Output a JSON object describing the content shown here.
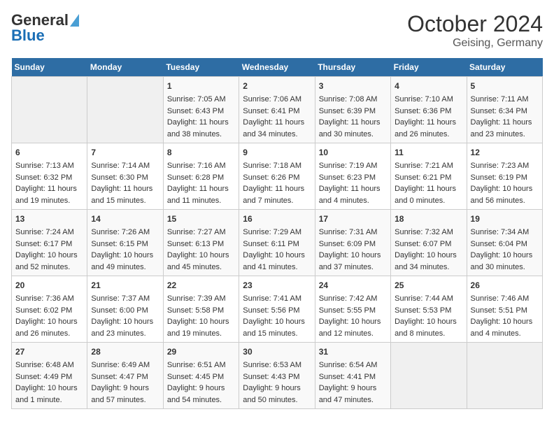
{
  "logo": {
    "part1": "General",
    "part2": "Blue"
  },
  "title": "October 2024",
  "subtitle": "Geising, Germany",
  "headers": [
    "Sunday",
    "Monday",
    "Tuesday",
    "Wednesday",
    "Thursday",
    "Friday",
    "Saturday"
  ],
  "weeks": [
    [
      {
        "day": "",
        "empty": true
      },
      {
        "day": "",
        "empty": true
      },
      {
        "day": "1",
        "sunrise": "Sunrise: 7:05 AM",
        "sunset": "Sunset: 6:43 PM",
        "daylight": "Daylight: 11 hours and 38 minutes."
      },
      {
        "day": "2",
        "sunrise": "Sunrise: 7:06 AM",
        "sunset": "Sunset: 6:41 PM",
        "daylight": "Daylight: 11 hours and 34 minutes."
      },
      {
        "day": "3",
        "sunrise": "Sunrise: 7:08 AM",
        "sunset": "Sunset: 6:39 PM",
        "daylight": "Daylight: 11 hours and 30 minutes."
      },
      {
        "day": "4",
        "sunrise": "Sunrise: 7:10 AM",
        "sunset": "Sunset: 6:36 PM",
        "daylight": "Daylight: 11 hours and 26 minutes."
      },
      {
        "day": "5",
        "sunrise": "Sunrise: 7:11 AM",
        "sunset": "Sunset: 6:34 PM",
        "daylight": "Daylight: 11 hours and 23 minutes."
      }
    ],
    [
      {
        "day": "6",
        "sunrise": "Sunrise: 7:13 AM",
        "sunset": "Sunset: 6:32 PM",
        "daylight": "Daylight: 11 hours and 19 minutes."
      },
      {
        "day": "7",
        "sunrise": "Sunrise: 7:14 AM",
        "sunset": "Sunset: 6:30 PM",
        "daylight": "Daylight: 11 hours and 15 minutes."
      },
      {
        "day": "8",
        "sunrise": "Sunrise: 7:16 AM",
        "sunset": "Sunset: 6:28 PM",
        "daylight": "Daylight: 11 hours and 11 minutes."
      },
      {
        "day": "9",
        "sunrise": "Sunrise: 7:18 AM",
        "sunset": "Sunset: 6:26 PM",
        "daylight": "Daylight: 11 hours and 7 minutes."
      },
      {
        "day": "10",
        "sunrise": "Sunrise: 7:19 AM",
        "sunset": "Sunset: 6:23 PM",
        "daylight": "Daylight: 11 hours and 4 minutes."
      },
      {
        "day": "11",
        "sunrise": "Sunrise: 7:21 AM",
        "sunset": "Sunset: 6:21 PM",
        "daylight": "Daylight: 11 hours and 0 minutes."
      },
      {
        "day": "12",
        "sunrise": "Sunrise: 7:23 AM",
        "sunset": "Sunset: 6:19 PM",
        "daylight": "Daylight: 10 hours and 56 minutes."
      }
    ],
    [
      {
        "day": "13",
        "sunrise": "Sunrise: 7:24 AM",
        "sunset": "Sunset: 6:17 PM",
        "daylight": "Daylight: 10 hours and 52 minutes."
      },
      {
        "day": "14",
        "sunrise": "Sunrise: 7:26 AM",
        "sunset": "Sunset: 6:15 PM",
        "daylight": "Daylight: 10 hours and 49 minutes."
      },
      {
        "day": "15",
        "sunrise": "Sunrise: 7:27 AM",
        "sunset": "Sunset: 6:13 PM",
        "daylight": "Daylight: 10 hours and 45 minutes."
      },
      {
        "day": "16",
        "sunrise": "Sunrise: 7:29 AM",
        "sunset": "Sunset: 6:11 PM",
        "daylight": "Daylight: 10 hours and 41 minutes."
      },
      {
        "day": "17",
        "sunrise": "Sunrise: 7:31 AM",
        "sunset": "Sunset: 6:09 PM",
        "daylight": "Daylight: 10 hours and 37 minutes."
      },
      {
        "day": "18",
        "sunrise": "Sunrise: 7:32 AM",
        "sunset": "Sunset: 6:07 PM",
        "daylight": "Daylight: 10 hours and 34 minutes."
      },
      {
        "day": "19",
        "sunrise": "Sunrise: 7:34 AM",
        "sunset": "Sunset: 6:04 PM",
        "daylight": "Daylight: 10 hours and 30 minutes."
      }
    ],
    [
      {
        "day": "20",
        "sunrise": "Sunrise: 7:36 AM",
        "sunset": "Sunset: 6:02 PM",
        "daylight": "Daylight: 10 hours and 26 minutes."
      },
      {
        "day": "21",
        "sunrise": "Sunrise: 7:37 AM",
        "sunset": "Sunset: 6:00 PM",
        "daylight": "Daylight: 10 hours and 23 minutes."
      },
      {
        "day": "22",
        "sunrise": "Sunrise: 7:39 AM",
        "sunset": "Sunset: 5:58 PM",
        "daylight": "Daylight: 10 hours and 19 minutes."
      },
      {
        "day": "23",
        "sunrise": "Sunrise: 7:41 AM",
        "sunset": "Sunset: 5:56 PM",
        "daylight": "Daylight: 10 hours and 15 minutes."
      },
      {
        "day": "24",
        "sunrise": "Sunrise: 7:42 AM",
        "sunset": "Sunset: 5:55 PM",
        "daylight": "Daylight: 10 hours and 12 minutes."
      },
      {
        "day": "25",
        "sunrise": "Sunrise: 7:44 AM",
        "sunset": "Sunset: 5:53 PM",
        "daylight": "Daylight: 10 hours and 8 minutes."
      },
      {
        "day": "26",
        "sunrise": "Sunrise: 7:46 AM",
        "sunset": "Sunset: 5:51 PM",
        "daylight": "Daylight: 10 hours and 4 minutes."
      }
    ],
    [
      {
        "day": "27",
        "sunrise": "Sunrise: 6:48 AM",
        "sunset": "Sunset: 4:49 PM",
        "daylight": "Daylight: 10 hours and 1 minute."
      },
      {
        "day": "28",
        "sunrise": "Sunrise: 6:49 AM",
        "sunset": "Sunset: 4:47 PM",
        "daylight": "Daylight: 9 hours and 57 minutes."
      },
      {
        "day": "29",
        "sunrise": "Sunrise: 6:51 AM",
        "sunset": "Sunset: 4:45 PM",
        "daylight": "Daylight: 9 hours and 54 minutes."
      },
      {
        "day": "30",
        "sunrise": "Sunrise: 6:53 AM",
        "sunset": "Sunset: 4:43 PM",
        "daylight": "Daylight: 9 hours and 50 minutes."
      },
      {
        "day": "31",
        "sunrise": "Sunrise: 6:54 AM",
        "sunset": "Sunset: 4:41 PM",
        "daylight": "Daylight: 9 hours and 47 minutes."
      },
      {
        "day": "",
        "empty": true
      },
      {
        "day": "",
        "empty": true
      }
    ]
  ]
}
